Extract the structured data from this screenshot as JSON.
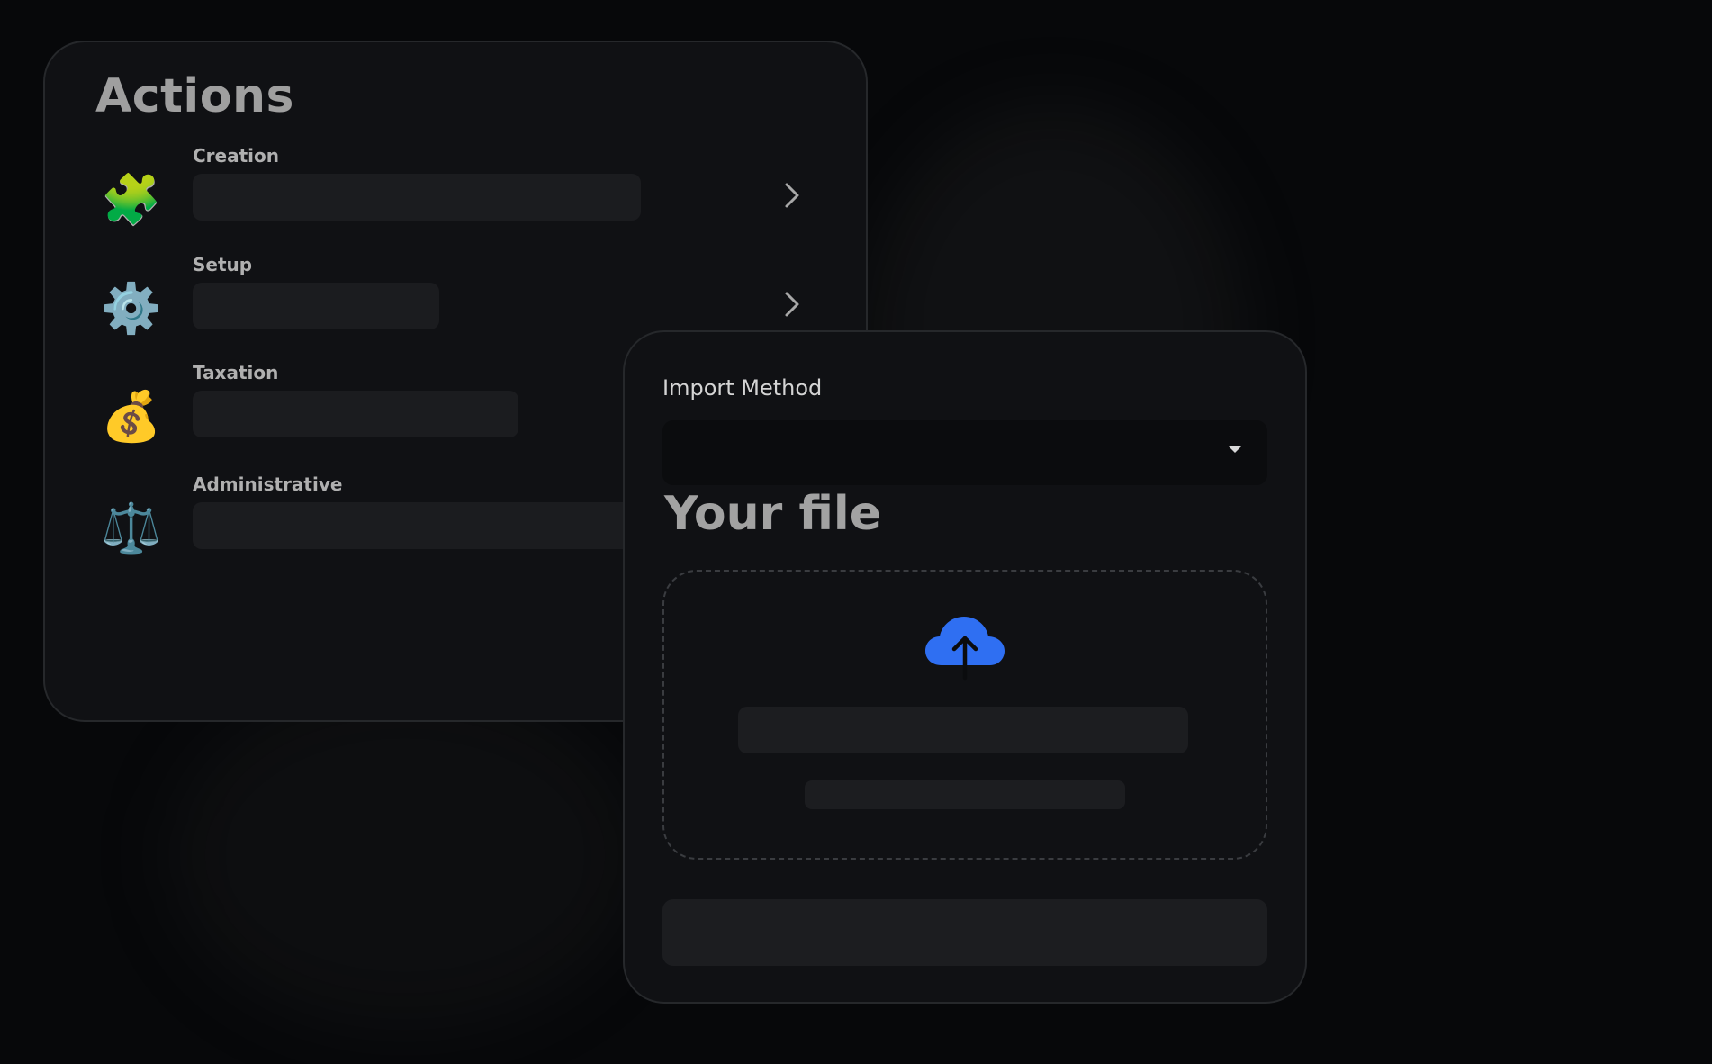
{
  "actions": {
    "title": "Actions",
    "items": [
      {
        "label": "Creation",
        "icon": "puzzle-icon",
        "glyph": "🧩",
        "has_chevron": true
      },
      {
        "label": "Setup",
        "icon": "gear-icon",
        "glyph": "⚙️",
        "has_chevron": true
      },
      {
        "label": "Taxation",
        "icon": "money-bag-icon",
        "glyph": "💰",
        "has_chevron": false
      },
      {
        "label": "Administrative",
        "icon": "scales-icon",
        "glyph": "⚖️",
        "has_chevron": false
      }
    ]
  },
  "import": {
    "method_label": "Import Method",
    "file_title": "Your file",
    "upload_icon": "cloud-upload-icon",
    "accent_color": "#2f6ff2"
  }
}
